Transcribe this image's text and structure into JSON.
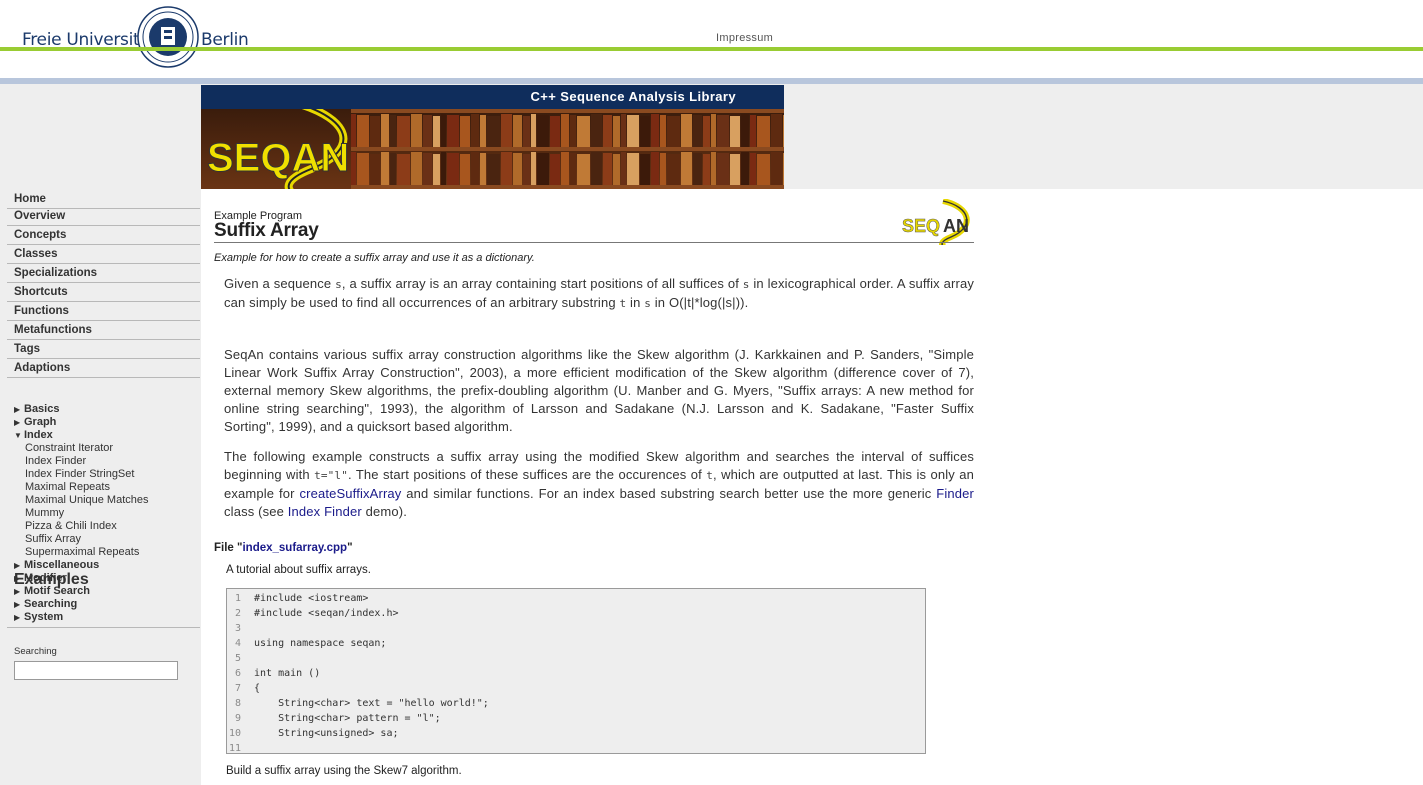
{
  "header": {
    "brand_left": "Freie Universität",
    "brand_right": "Berlin",
    "impressum_link": "Impressum",
    "seal_icon": "university-seal-icon"
  },
  "banner": {
    "tagline": "C++ Sequence Analysis Library",
    "logo_text": "SEQAN"
  },
  "sidebar": {
    "nav": [
      "Home",
      "Overview",
      "Concepts",
      "Classes",
      "Specializations",
      "Shortcuts",
      "Functions",
      "Metafunctions",
      "Tags",
      "Adaptions"
    ],
    "examples_title": "Examples",
    "examples_tree": [
      {
        "label": "Basics",
        "expanded": false
      },
      {
        "label": "Graph",
        "expanded": false
      },
      {
        "label": "Index",
        "expanded": true
      }
    ],
    "index_children": [
      "Constraint Iterator",
      "Index Finder",
      "Index Finder StringSet",
      "Maximal Repeats",
      "Maximal Unique Matches",
      "Mummy",
      "Pizza & Chili Index",
      "Suffix Array",
      "Supermaximal Repeats"
    ],
    "examples_tree_rest": [
      {
        "label": "Miscellaneous",
        "expanded": false
      },
      {
        "label": "Modifier",
        "expanded": false
      },
      {
        "label": "Motif Search",
        "expanded": false
      },
      {
        "label": "Searching",
        "expanded": false
      },
      {
        "label": "System",
        "expanded": false
      }
    ],
    "search_label": "Searching",
    "search_value": ""
  },
  "main": {
    "example_label": "Example Program",
    "title": "Suffix Array",
    "subtitle": "Example for how to create a suffix array and use it as a dictionary.",
    "p1": {
      "a": "Given a sequence ",
      "s1": "s",
      "b": ", a suffix array is an array containing start positions of all suffices of ",
      "s2": "s",
      "c": " in lexicographical order. A suffix array can simply be used to find all occurrences of an arbitrary substring ",
      "t1": "t",
      "d": " in ",
      "s3": "s",
      "e": " in O(|t|*log(|s|))."
    },
    "p2": "SeqAn contains various suffix array construction algorithms like the Skew algorithm (J. Karkkainen and P. Sanders, \"Simple Linear Work Suffix Array Construction\", 2003), a more efficient modification of the Skew algorithm (difference cover of 7), external memory Skew algorithms, the prefix-doubling algorithm (U. Manber and G. Myers, \"Suffix arrays: A new method for online string searching\", 1993), the algorithm of Larsson and Sadakane (N.J. Larsson and K. Sadakane, \"Faster Suffix Sorting\", 1999), and a quicksort based algorithm.",
    "p3": {
      "a": "The following example constructs a suffix array using the modified Skew algorithm and searches the interval of suffices beginning with ",
      "code1": "t=\"l\"",
      "b": ". The start positions of these suffices are the occurences of ",
      "code2": "t",
      "c": ", which are outputted at last. This is only an example for ",
      "link1": "createSuffixArray",
      "d": " and similar functions. For an index based substring search better use the more generic ",
      "link2": "Finder",
      "e": " class (see ",
      "link3": "Index Finder",
      "f": " demo)."
    },
    "file_prefix": "File \"",
    "file_link": "index_sufarray.cpp",
    "file_suffix": "\"",
    "tutorial_note": "A tutorial about suffix arrays.",
    "code_lines": [
      {
        "n": "1",
        "t": "#include <iostream>"
      },
      {
        "n": "2",
        "t": "#include <seqan/index.h>"
      },
      {
        "n": "3",
        "t": ""
      },
      {
        "n": "4",
        "t": "using namespace seqan;"
      },
      {
        "n": "5",
        "t": ""
      },
      {
        "n": "6",
        "t": "int main ()"
      },
      {
        "n": "7",
        "t": "{"
      },
      {
        "n": "8",
        "t": "    String<char> text = \"hello world!\";"
      },
      {
        "n": "9",
        "t": "    String<char> pattern = \"l\";"
      },
      {
        "n": "10",
        "t": "    String<unsigned> sa;"
      },
      {
        "n": "11",
        "t": ""
      }
    ],
    "after_code": "Build a suffix array using the Skew7 algorithm."
  }
}
